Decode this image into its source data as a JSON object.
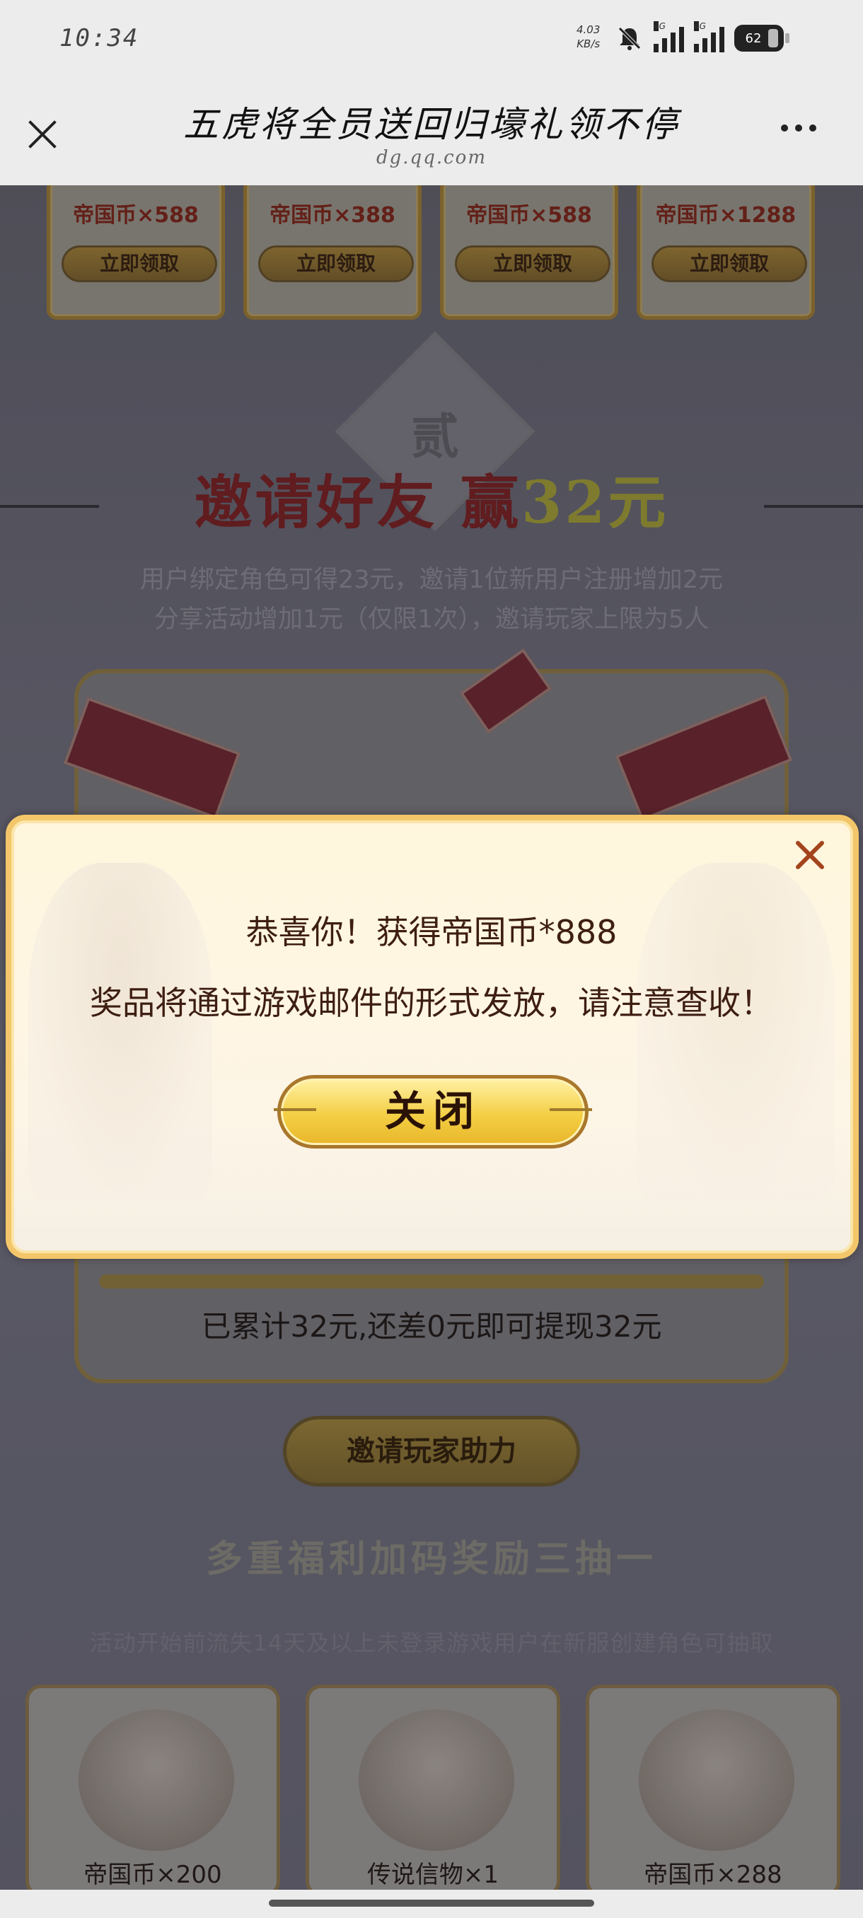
{
  "status": {
    "time": "10:34",
    "speed_value": "4.03",
    "speed_unit": "KB/s",
    "network_1": "4G",
    "network_2": "4G",
    "battery": "62"
  },
  "nav": {
    "title": "五虎将全员送回归壕礼领不停",
    "url": "dg.qq.com"
  },
  "rewards": [
    {
      "label": "帝国币×588",
      "button": "立即领取"
    },
    {
      "label": "帝国币×388",
      "button": "立即领取"
    },
    {
      "label": "帝国币×588",
      "button": "立即领取"
    },
    {
      "label": "帝国币×1288",
      "button": "立即领取"
    }
  ],
  "invite_section": {
    "badge": "贰",
    "title_main": "邀请好友 赢",
    "title_accent": "32元",
    "desc_line1": "用户绑定角色可得23元，邀请1位新用户注册增加2元",
    "desc_line2": "分享活动增加1元（仅限1次），邀请玩家上限为5人",
    "progress_text": "已累计32元,还差0元即可提现32元",
    "invite_button": "邀请玩家助力"
  },
  "multi_section": {
    "title": "多重福利加码奖励三抽一",
    "desc": "活动开始前流失14天及以上未登录游戏用户在新服创建角色可抽取",
    "prizes": [
      {
        "label": "帝国币×200"
      },
      {
        "label": "传说信物×1"
      },
      {
        "label": "帝国币×288"
      }
    ]
  },
  "modal": {
    "line1": "恭喜你！获得帝国币*888",
    "line2": "奖品将通过游戏邮件的形式发放，请注意查收！",
    "button": "关闭"
  }
}
